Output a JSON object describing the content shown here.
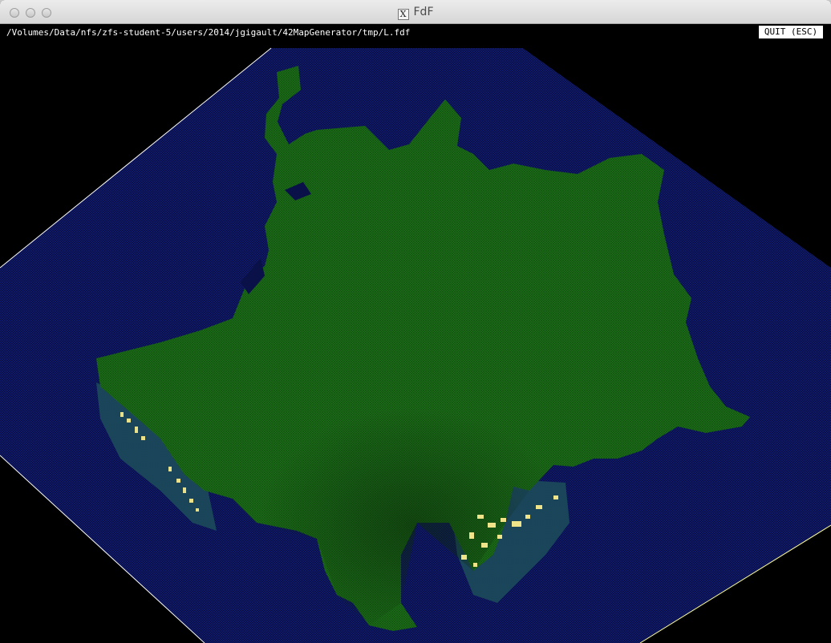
{
  "window": {
    "title": "FdF",
    "title_icon": "x11-icon",
    "title_icon_glyph": "X"
  },
  "toolbar": {
    "file_path": "/Volumes/Data/nfs/zfs-student-5/users/2014/jgigault/42MapGenerator/tmp/L.fdf",
    "quit_label": "QUIT (ESC)"
  },
  "render": {
    "description_colors": {
      "sea": "#0a0f4a",
      "land": "#1f7a1a",
      "land_dark": "#164d14",
      "peaks": "#e8e08a",
      "border": "#ffffff"
    }
  }
}
